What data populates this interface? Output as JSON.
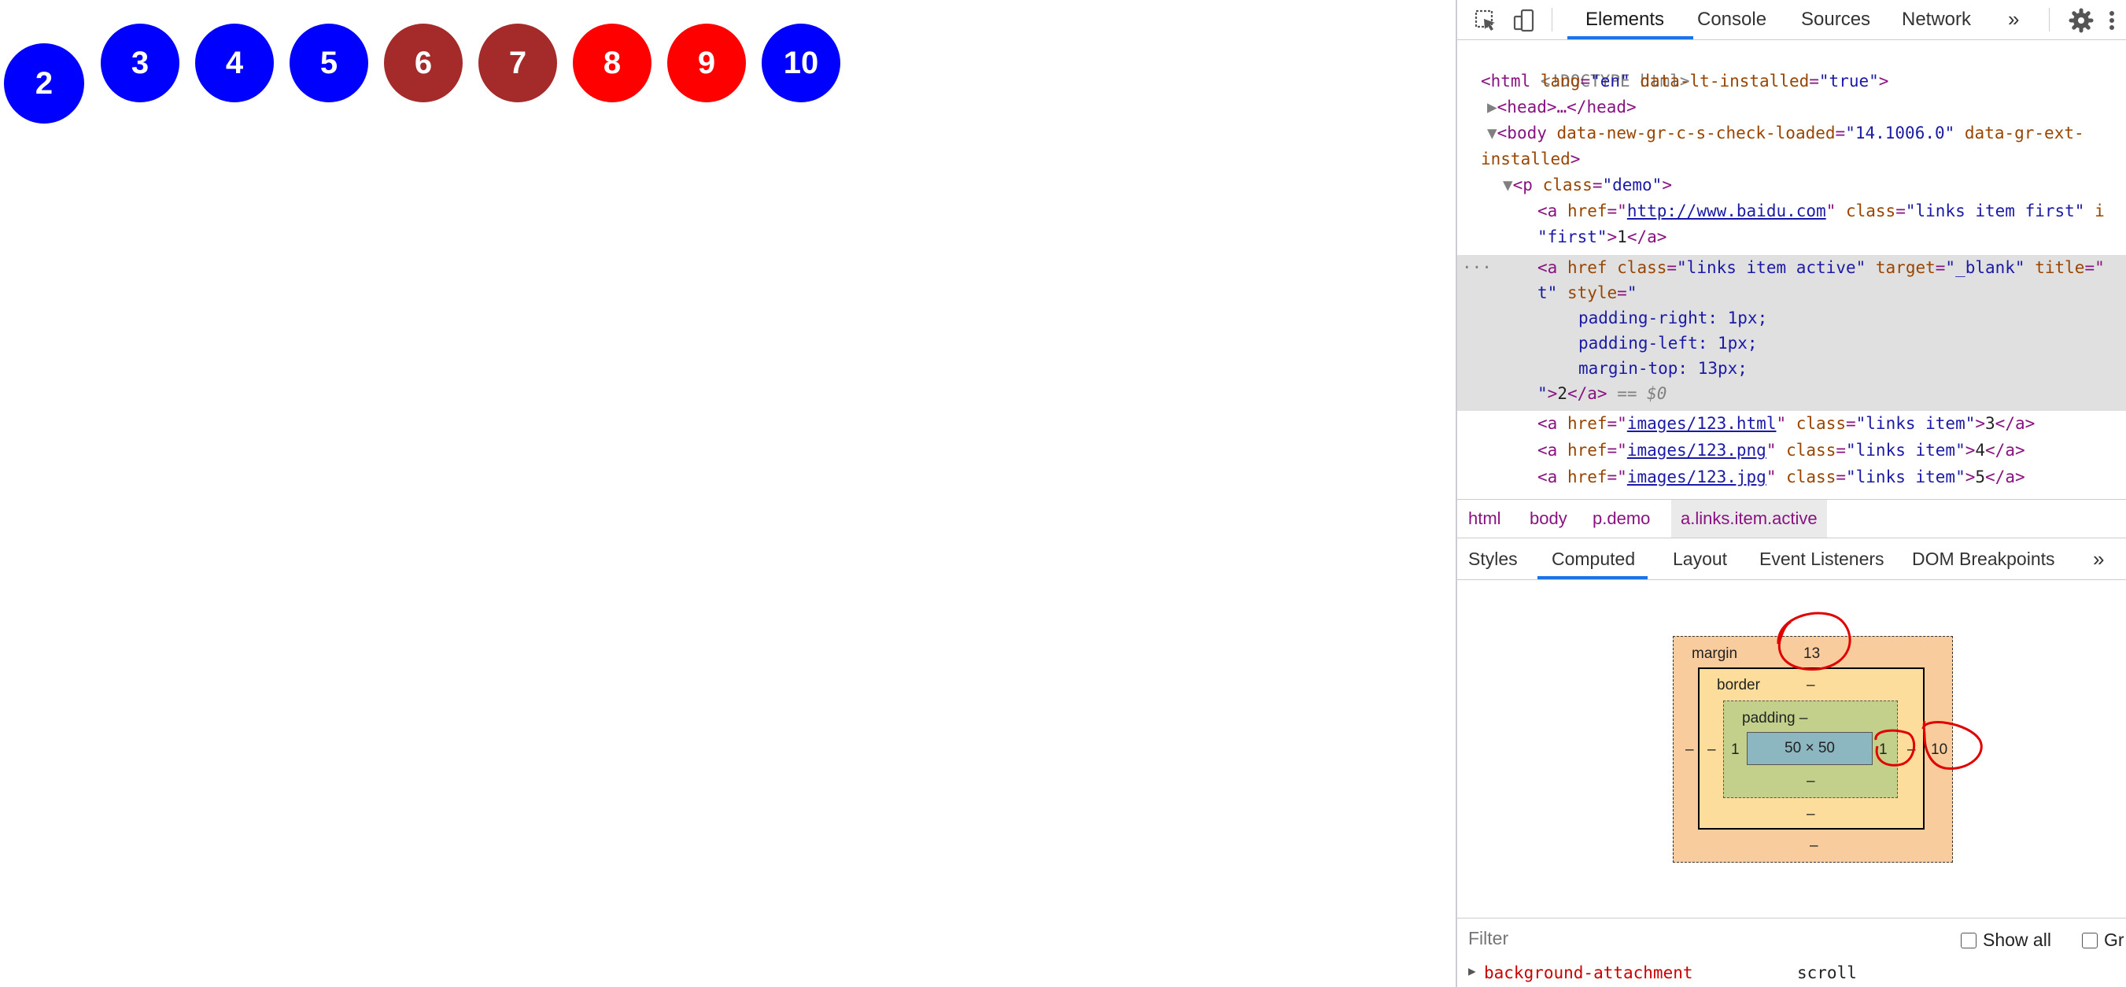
{
  "page": {
    "circles": [
      {
        "label": "2",
        "color": "#0000ff"
      },
      {
        "label": "3",
        "color": "#0000ff"
      },
      {
        "label": "4",
        "color": "#0000ff"
      },
      {
        "label": "5",
        "color": "#0000ff"
      },
      {
        "label": "6",
        "color": "#a52a2a"
      },
      {
        "label": "7",
        "color": "#a52a2a"
      },
      {
        "label": "8",
        "color": "#ff0000"
      },
      {
        "label": "9",
        "color": "#ff0000"
      },
      {
        "label": "10",
        "color": "#0000ff"
      }
    ]
  },
  "devtools": {
    "tabs": [
      "Elements",
      "Console",
      "Sources",
      "Network"
    ],
    "active_tab": "Elements",
    "more": "»",
    "dom_lines": {
      "doctype": "<!DOCTYPE html>",
      "html_open_tag": "<html",
      "html_lang_attr": " lang",
      "html_lang_val": "\"en\"",
      "html_lt_attr": " data-lt-installed",
      "html_lt_val": "\"true\"",
      "html_close": ">",
      "head": "<head>…</head>",
      "body_tag": "<body",
      "body_attr1": " data-new-gr-c-s-check-loaded",
      "body_val1": "\"14.1006.0\"",
      "body_attr2": " data-gr-ext-",
      "body_attr2_cont": "installed",
      "p_tag": "<p",
      "p_attr": " class",
      "p_val": "\"demo\"",
      "a1_tag": "<a",
      "a1_href_attr": " href",
      "a1_href_val": "http://www.baidu.com",
      "a1_class_attr": " class",
      "a1_class_val": "\"links item first\"",
      "a1_trunc": " i",
      "a1_cont_val": "\"first\"",
      "a1_text": "1",
      "a2_tag": "<a",
      "a2_href_attr": " href",
      "a2_class_attr": " class",
      "a2_class_val": "\"links item active\"",
      "a2_target_attr": " target",
      "a2_target_val": "\"_blank\"",
      "a2_title_attr": " title",
      "a2_title_cont": "t\"",
      "a2_style_attr": " style",
      "a2_style_open": "\"",
      "a2_style1": "padding-right: 1px;",
      "a2_style2": "padding-left: 1px;",
      "a2_style3": "margin-top: 13px;",
      "a2_style_close": "\"",
      "a2_text": "2",
      "a2_dollar": " == $0",
      "a3_href": "images/123.html",
      "a3_class": "\"links item\"",
      "a3_text": "3",
      "a4_href": "images/123.png",
      "a4_class": "\"links item\"",
      "a4_text": "4",
      "a5_href": "images/123.jpg",
      "a5_class": "\"links item\"",
      "a5_text": "5",
      "ellipsis": "···"
    },
    "breadcrumbs": [
      "html",
      "body",
      "p.demo",
      "a.links.item.active"
    ],
    "subtabs": [
      "Styles",
      "Computed",
      "Layout",
      "Event Listeners",
      "DOM Breakpoints"
    ],
    "active_subtab": "Computed",
    "subtabs_more": "»",
    "box_model": {
      "margin_label": "margin",
      "margin_top": "13",
      "margin_right": "10",
      "margin_bottom": "–",
      "margin_left": "–",
      "border_label": "border",
      "border_top": "–",
      "border_right": "–",
      "border_bottom": "–",
      "border_left": "–",
      "padding_label": "padding –",
      "padding_right": "1",
      "padding_bottom": "–",
      "padding_left": "1",
      "content": "50 × 50",
      "colors": {
        "margin": "#f9cc9d",
        "border": "#fddd9b",
        "padding": "#c3d08b",
        "content": "#8cb6c0",
        "annotation": "#e00000"
      }
    },
    "filter": {
      "placeholder": "Filter",
      "show_all": "Show all",
      "group": "Gr"
    },
    "computed_row": {
      "property": "background-attachment",
      "value": "scroll"
    }
  }
}
